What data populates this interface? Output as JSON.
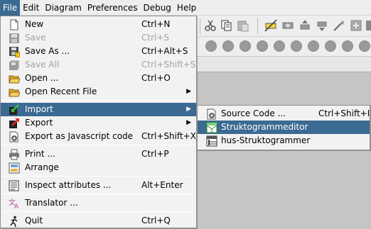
{
  "menubar": {
    "file": "File",
    "edit": "Edit",
    "diagram": "Diagram",
    "preferences": "Preferences",
    "debug": "Debug",
    "help": "Help"
  },
  "file_menu": {
    "new": {
      "label": "New",
      "shortcut": "Ctrl+N"
    },
    "save": {
      "label": "Save",
      "shortcut": "Ctrl+S"
    },
    "save_as": {
      "label": "Save As ...",
      "shortcut": "Ctrl+Alt+S"
    },
    "save_all": {
      "label": "Save All",
      "shortcut": "Ctrl+Shift+S"
    },
    "open": {
      "label": "Open ...",
      "shortcut": "Ctrl+O"
    },
    "open_recent": {
      "label": "Open Recent File"
    },
    "import": {
      "label": "Import"
    },
    "export": {
      "label": "Export"
    },
    "export_js": {
      "label": "Export as Javascript code",
      "shortcut": "Ctrl+Shift+X"
    },
    "print": {
      "label": "Print ...",
      "shortcut": "Ctrl+P"
    },
    "arrange": {
      "label": "Arrange"
    },
    "inspect": {
      "label": "Inspect attributes ...",
      "shortcut": "Alt+Enter"
    },
    "translator": {
      "label": "Translator ..."
    },
    "quit": {
      "label": "Quit",
      "shortcut": "Ctrl+Q"
    }
  },
  "import_submenu": {
    "source_code": {
      "label": "Source Code ...",
      "shortcut": "Ctrl+Shift+I"
    },
    "struktogrammeditor": {
      "label": "Struktogrammeditor"
    },
    "hus": {
      "label": "hus-Struktogrammer"
    }
  },
  "colors": {
    "selection": "#3b6a92",
    "menu_bg": "#f2f2f2",
    "disabled_text": "#a3a3a3",
    "workspace": "#c5c5c5"
  }
}
